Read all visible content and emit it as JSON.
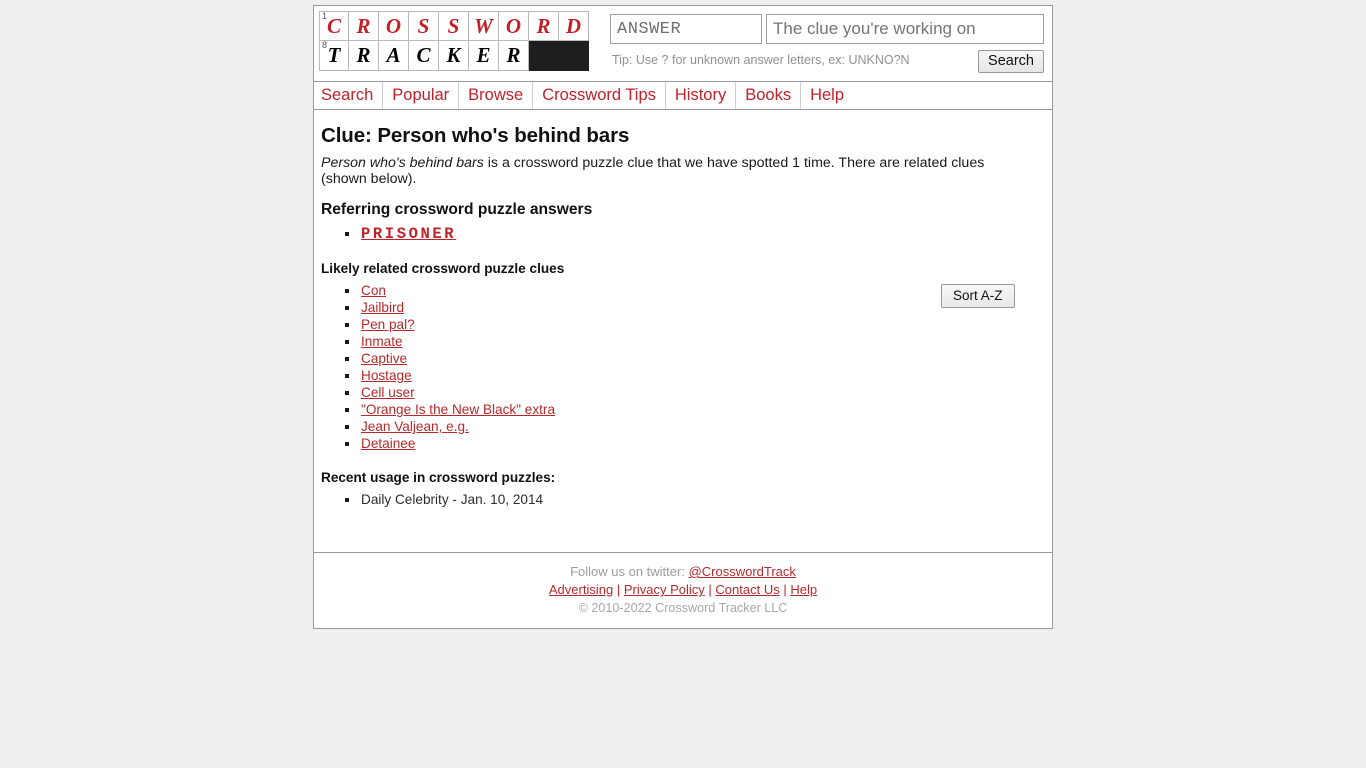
{
  "header": {
    "logo": {
      "row1_number": "1",
      "row1_letters": [
        "C",
        "R",
        "O",
        "S",
        "S",
        "W",
        "O",
        "R",
        "D"
      ],
      "row2_number": "8",
      "row2_letters": [
        "T",
        "R",
        "A",
        "C",
        "K",
        "E",
        "R"
      ],
      "red_color": "#c02026",
      "black_cell_color": "#201d1d"
    },
    "search": {
      "answer_value": "",
      "answer_placeholder": "ANSWER",
      "clue_value": "",
      "clue_placeholder": "The clue you're working on",
      "tip": "Tip: Use ? for unknown answer letters, ex: UNKNO?N",
      "button_label": "Search"
    }
  },
  "nav": {
    "items": [
      {
        "label": "Search"
      },
      {
        "label": "Popular"
      },
      {
        "label": "Browse"
      },
      {
        "label": "Crossword Tips"
      },
      {
        "label": "History"
      },
      {
        "label": "Books"
      },
      {
        "label": "Help"
      }
    ]
  },
  "main": {
    "title": "Clue: Person who's behind bars",
    "description": {
      "emphasis": "Person who's behind bars",
      "rest": " is a crossword puzzle clue that we have spotted 1 time. There are related clues (shown below)."
    },
    "answers_heading": "Referring crossword puzzle answers",
    "answers": [
      {
        "label": "PRISONER"
      }
    ],
    "related_heading": "Likely related crossword puzzle clues",
    "sort_button_label": "Sort A-Z",
    "related_clues": [
      {
        "label": "Con"
      },
      {
        "label": "Jailbird"
      },
      {
        "label": "Pen pal?"
      },
      {
        "label": "Inmate"
      },
      {
        "label": "Captive"
      },
      {
        "label": "Hostage"
      },
      {
        "label": "Cell user"
      },
      {
        "label": "\"Orange Is the New Black\" extra"
      },
      {
        "label": "Jean Valjean, e.g."
      },
      {
        "label": "Detainee"
      }
    ],
    "usage_heading": "Recent usage in crossword puzzles:",
    "usage": [
      {
        "label": "Daily Celebrity - Jan. 10, 2014"
      }
    ]
  },
  "footer": {
    "twitter_prefix": "Follow us on twitter: ",
    "twitter_handle": "@CrosswordTrack",
    "links": [
      {
        "label": "Advertising"
      },
      {
        "label": "Privacy Policy"
      },
      {
        "label": "Contact Us"
      },
      {
        "label": "Help"
      }
    ],
    "separator": "|",
    "copyright": "© 2010-2022 Crossword Tracker LLC"
  }
}
